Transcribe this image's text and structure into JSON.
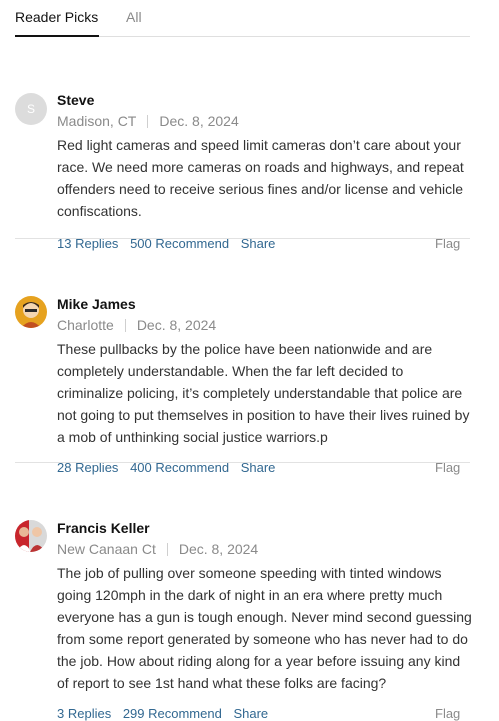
{
  "tabs": {
    "reader_picks": "Reader Picks",
    "all": "All"
  },
  "comments": [
    {
      "initial": "S",
      "name": "Steve",
      "location": "Madison, CT",
      "date": "Dec. 8, 2024",
      "lines": [
        "Red light cameras and speed limit cameras don’t care about your",
        "race.  We need more cameras on roads and highways, and repeat",
        "offenders need to receive serious fines and/or license and vehicle",
        "confiscations."
      ],
      "replies": "13 Replies",
      "recommend": "500 Recommend",
      "share": "Share",
      "flag": "Flag"
    },
    {
      "name": "Mike James",
      "location": "Charlotte",
      "date": "Dec. 8, 2024",
      "lines": [
        "These pullbacks by the police have been nationwide and are",
        "completely understandable. When the far left decided to",
        "criminalize policing, it’s completely understandable that police are",
        "not going to put themselves in position to have their lives ruined by",
        "a mob of unthinking social justice warriors.p"
      ],
      "replies": "28 Replies",
      "recommend": "400 Recommend",
      "share": "Share",
      "flag": "Flag"
    },
    {
      "name": "Francis Keller",
      "location": "New Canaan Ct",
      "date": "Dec. 8, 2024",
      "lines": [
        "The job of pulling over someone speeding with tinted windows",
        "going 120mph in the dark of night in an era where pretty much",
        "everyone has a gun is tough enough.  Never mind second guessing",
        "from some report generated by someone who  has never had to do",
        "the job.  How about riding along for a year before issuing any kind",
        "of report to see 1st hand what these folks are facing?"
      ],
      "replies": "3 Replies",
      "recommend": "299 Recommend",
      "share": "Share",
      "flag": "Flag"
    }
  ]
}
